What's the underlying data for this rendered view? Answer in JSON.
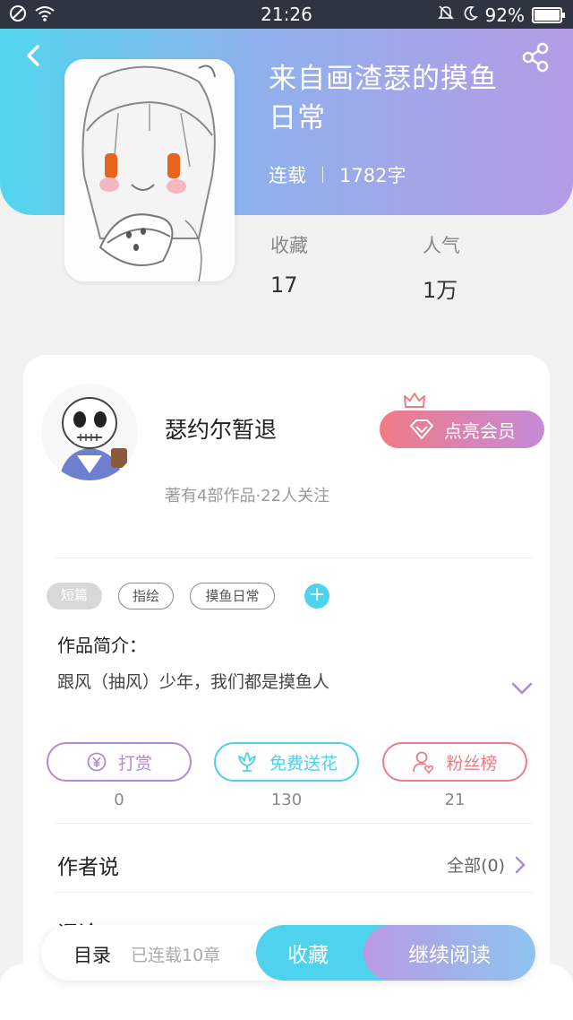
{
  "status_bar": {
    "time": "21:26",
    "battery": "92%",
    "battery_level": 0.92
  },
  "book": {
    "title_line1": "来自画渣瑟的摸鱼",
    "title_line2": "日常",
    "status": "连载",
    "word_count": "1782字",
    "stats": [
      {
        "label": "收藏",
        "value": "17"
      },
      {
        "label": "人气",
        "value": "1万"
      }
    ]
  },
  "author": {
    "name": "瑟约尔暂退",
    "sub": "著有4部作品·22人关注",
    "vip_label": "点亮会员"
  },
  "tags": [
    "短篇",
    "指绘",
    "摸鱼日常"
  ],
  "tag_add": "+",
  "intro": {
    "label": "作品简介：",
    "text": "跟风（抽风）少年，我们都是摸鱼人"
  },
  "actions": [
    {
      "label": "打赏",
      "count": "0",
      "color": "#b08ad8",
      "icon": "yen-coin-icon"
    },
    {
      "label": "免费送花",
      "count": "130",
      "color": "#4fcfe8",
      "icon": "flower-icon"
    },
    {
      "label": "粉丝榜",
      "count": "21",
      "color": "#ef7b83",
      "icon": "fan-user-icon"
    }
  ],
  "author_says": {
    "title": "作者说",
    "right": "全部(0)"
  },
  "comments": {
    "title": "评论"
  },
  "bottom": {
    "catalog": "目录",
    "chapters": "已连载10章",
    "favorite": "收藏",
    "continue": "继续阅读"
  }
}
